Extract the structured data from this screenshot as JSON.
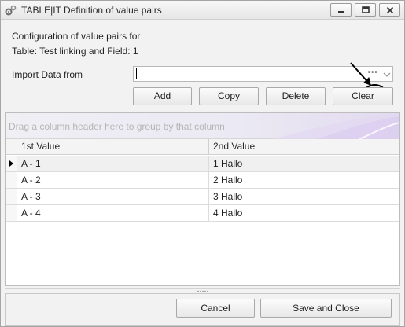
{
  "window": {
    "title": "TABLE|IT Definition of value pairs",
    "icon": "gears-icon",
    "controls": [
      "minimize-icon",
      "maximize-icon",
      "close-icon"
    ]
  },
  "intro": {
    "line1": "Configuration of value pairs for",
    "line2": "Table: Test linking and Field: 1"
  },
  "import": {
    "label": "Import Data from",
    "value": "",
    "placeholder": "",
    "browse_label": "···"
  },
  "toolbar": {
    "add_label": "Add",
    "copy_label": "Copy",
    "delete_label": "Delete",
    "clear_label": "Clear"
  },
  "grid": {
    "group_hint": "Drag a column header here to group by that column",
    "columns": [
      "1st Value",
      "2nd Value"
    ],
    "rows": [
      [
        "A - 1",
        "1 Hallo"
      ],
      [
        "A - 2",
        "2 Hallo"
      ],
      [
        "A - 3",
        "3 Hallo"
      ],
      [
        "A - 4",
        "4 Hallo"
      ]
    ],
    "selected_row": 0
  },
  "footer": {
    "cancel_label": "Cancel",
    "save_close_label": "Save and Close"
  },
  "colors": {
    "window_bg": "#f2f2f2",
    "group_panel_accent": "#d9c9ef",
    "annotation": "#000000"
  }
}
